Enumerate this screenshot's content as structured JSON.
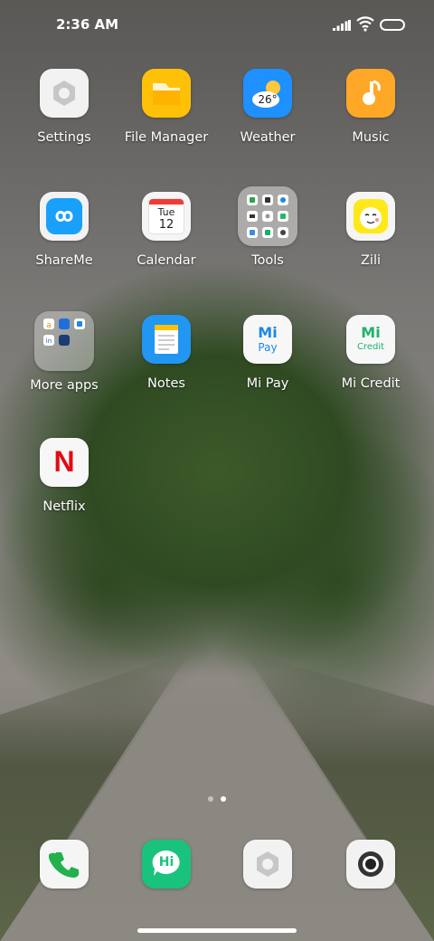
{
  "status_bar": {
    "time": "2:36 AM"
  },
  "apps": [
    {
      "id": "settings",
      "label": "Settings"
    },
    {
      "id": "file-manager",
      "label": "File Manager"
    },
    {
      "id": "weather",
      "label": "Weather",
      "temp": "26°"
    },
    {
      "id": "music",
      "label": "Music"
    },
    {
      "id": "shareme",
      "label": "ShareMe"
    },
    {
      "id": "calendar",
      "label": "Calendar",
      "day": "Tue",
      "date": "12"
    },
    {
      "id": "tools",
      "label": "Tools"
    },
    {
      "id": "zili",
      "label": "Zili"
    },
    {
      "id": "more-apps",
      "label": "More apps"
    },
    {
      "id": "notes",
      "label": "Notes"
    },
    {
      "id": "mi-pay",
      "label": "Mi Pay",
      "logo_top": "Mi",
      "logo_bottom": "Pay"
    },
    {
      "id": "mi-credit",
      "label": "Mi Credit",
      "logo_top": "Mi",
      "logo_bottom": "Credit"
    },
    {
      "id": "netflix",
      "label": "Netflix",
      "logo": "N"
    }
  ],
  "dock": [
    {
      "id": "phone"
    },
    {
      "id": "messages",
      "text": "Hi"
    },
    {
      "id": "browser"
    },
    {
      "id": "camera"
    }
  ],
  "page_indicator": {
    "pages": 2,
    "active": 2
  },
  "colors": {
    "weather_bg": "#1e90ff",
    "music_bg": "#ffa726",
    "file_manager_bg": "#ffc107",
    "notes_bg": "#2196f3",
    "messages_bg": "#19c37d",
    "mi_green": "#21b26b",
    "mi_blue": "#1e88e5"
  }
}
